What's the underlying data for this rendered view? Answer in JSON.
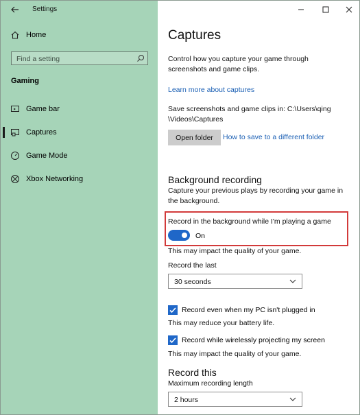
{
  "window": {
    "title": "Settings"
  },
  "sidebar": {
    "home": "Home",
    "search_placeholder": "Find a setting",
    "section": "Gaming",
    "items": [
      {
        "label": "Game bar",
        "icon": "game-bar-icon"
      },
      {
        "label": "Captures",
        "icon": "captures-icon",
        "active": true
      },
      {
        "label": "Game Mode",
        "icon": "game-mode-icon"
      },
      {
        "label": "Xbox Networking",
        "icon": "xbox-icon"
      }
    ]
  },
  "main": {
    "title": "Captures",
    "intro_line1": "Control how you capture your game through",
    "intro_line2": "screenshots and game clips.",
    "learn_more": "Learn more about captures",
    "save_line1": "Save screenshots and game clips in: C:\\Users\\qing",
    "save_line2": "\\Videos\\Captures",
    "open_folder": "Open folder",
    "how_to_save": "How to save to a different folder",
    "background": {
      "heading": "Background recording",
      "desc_line1": "Capture your previous plays by recording your game in",
      "desc_line2": "the background.",
      "toggle_label": "Record in the background while I'm playing a game",
      "toggle_state": "On",
      "impact_note": "This may impact the quality of your game.",
      "record_last_label": "Record the last",
      "record_last_value": "30 seconds",
      "checkbox1_label": "Record even when my PC isn't plugged in",
      "checkbox1_note": "This may reduce your battery life.",
      "checkbox2_label": "Record while wirelessly projecting my screen",
      "checkbox2_note": "This may impact the quality of your game."
    },
    "record_this": {
      "heading": "Record this",
      "max_length_label": "Maximum recording length",
      "max_length_value": "2 hours"
    }
  },
  "colors": {
    "sidebar_bg": "#a6d4b8",
    "accent": "#1f67c8",
    "highlight_border": "#d23a3a"
  }
}
